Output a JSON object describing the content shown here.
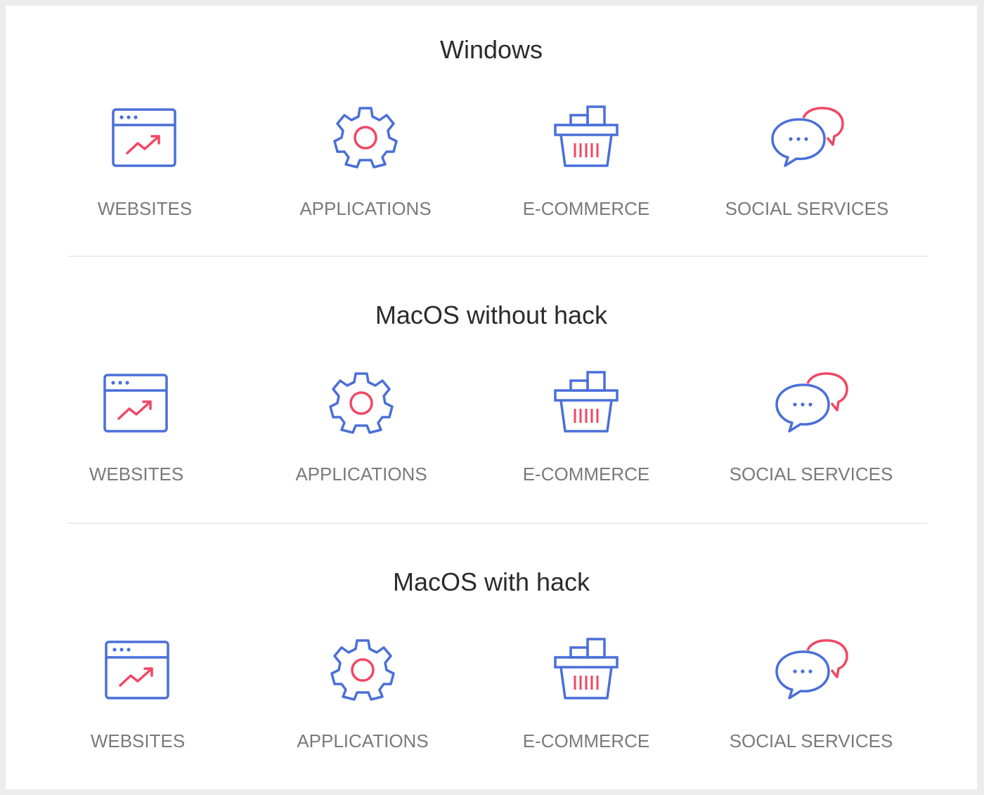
{
  "colors": {
    "blue": "#4a6fd8",
    "red": "#f04763",
    "label": "#7a7a7a",
    "title": "#2b2b2b"
  },
  "sections": [
    {
      "title": "Windows",
      "items": [
        {
          "label": "WEBSITES",
          "icon": "browser-chart-icon"
        },
        {
          "label": "APPLICATIONS",
          "icon": "gear-icon"
        },
        {
          "label": "E-COMMERCE",
          "icon": "basket-icon"
        },
        {
          "label": "SOCIAL SERVICES",
          "icon": "chat-bubbles-icon"
        }
      ]
    },
    {
      "title": "MacOS without hack",
      "items": [
        {
          "label": "WEBSITES",
          "icon": "browser-chart-icon"
        },
        {
          "label": "APPLICATIONS",
          "icon": "gear-icon"
        },
        {
          "label": "E-COMMERCE",
          "icon": "basket-icon"
        },
        {
          "label": "SOCIAL SERVICES",
          "icon": "chat-bubbles-icon"
        }
      ]
    },
    {
      "title": "MacOS with hack",
      "items": [
        {
          "label": "WEBSITES",
          "icon": "browser-chart-icon"
        },
        {
          "label": "APPLICATIONS",
          "icon": "gear-icon"
        },
        {
          "label": "E-COMMERCE",
          "icon": "basket-icon"
        },
        {
          "label": "SOCIAL SERVICES",
          "icon": "chat-bubbles-icon"
        }
      ]
    }
  ]
}
